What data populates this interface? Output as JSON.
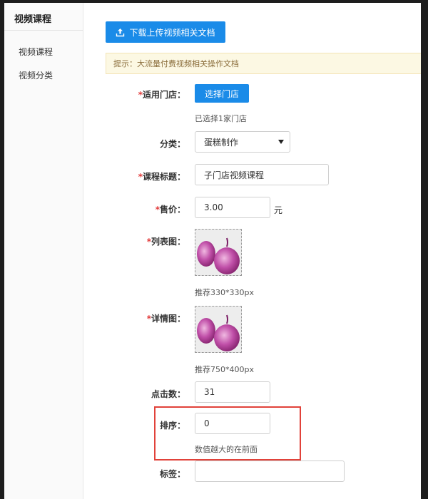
{
  "sidebar": {
    "title": "视频课程",
    "items": [
      {
        "label": "视频课程"
      },
      {
        "label": "视频分类"
      }
    ]
  },
  "toolbar": {
    "download_label": "下载上传视频相关文档"
  },
  "tip": {
    "text": "提示：大流量付费视频相关操作文档"
  },
  "form": {
    "store": {
      "label": "适用门店：",
      "required": "*",
      "button_label": "选择门店",
      "selected_text": "已选择1家门店"
    },
    "category": {
      "label": "分类：",
      "value": "蛋糕制作"
    },
    "course_title": {
      "label": "课程标题：",
      "required": "*",
      "value": "子门店视频课程"
    },
    "price": {
      "label": "售价：",
      "required": "*",
      "value": "3.00",
      "unit": "元"
    },
    "list_image": {
      "label": "列表图：",
      "required": "*",
      "hint": "推荐330*330px"
    },
    "detail_image": {
      "label": "详情图：",
      "required": "*",
      "hint": "推荐750*400px"
    },
    "clicks": {
      "label": "点击数：",
      "value": "31"
    },
    "sort": {
      "label": "排序：",
      "value": "0",
      "hint": "数值越大的在前面"
    },
    "tags": {
      "label": "标签：",
      "value": ""
    }
  },
  "colors": {
    "primary": "#1a8be8",
    "required": "#e23c3c",
    "highlight": "#e1423a"
  }
}
